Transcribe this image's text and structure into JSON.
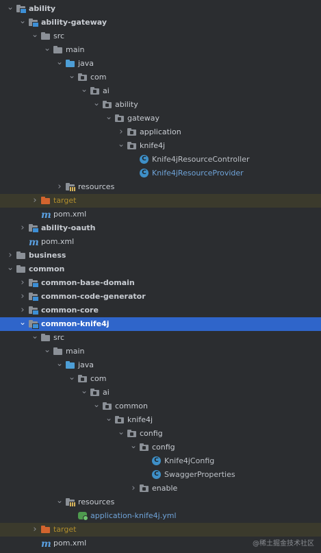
{
  "project_tree": {
    "rows": [
      {
        "label": "ability",
        "level": 0,
        "expanded": true,
        "icon": "module-folder-icon",
        "bold": true
      },
      {
        "label": "ability-gateway",
        "level": 1,
        "expanded": true,
        "icon": "module-folder-icon",
        "bold": true
      },
      {
        "label": "src",
        "level": 2,
        "expanded": true,
        "icon": "folder-icon"
      },
      {
        "label": "main",
        "level": 3,
        "expanded": true,
        "icon": "folder-icon"
      },
      {
        "label": "java",
        "level": 4,
        "expanded": true,
        "icon": "source-folder-icon"
      },
      {
        "label": "com",
        "level": 5,
        "expanded": true,
        "icon": "package-icon"
      },
      {
        "label": "ai",
        "level": 6,
        "expanded": true,
        "icon": "package-icon"
      },
      {
        "label": "ability",
        "level": 7,
        "expanded": true,
        "icon": "package-icon"
      },
      {
        "label": "gateway",
        "level": 8,
        "expanded": true,
        "icon": "package-icon"
      },
      {
        "label": "application",
        "level": 9,
        "expanded": false,
        "icon": "package-icon"
      },
      {
        "label": "knife4j",
        "level": 9,
        "expanded": true,
        "icon": "package-icon"
      },
      {
        "label": "Knife4jResourceController",
        "level": 10,
        "icon": "class-icon",
        "style": "class"
      },
      {
        "label": "Knife4jResourceProvider",
        "level": 10,
        "icon": "class-icon",
        "style": "link"
      },
      {
        "label": "resources",
        "level": 4,
        "expanded": false,
        "icon": "resources-folder-icon"
      },
      {
        "label": "target",
        "level": 2,
        "expanded": false,
        "icon": "excluded-folder-icon",
        "style": "excluded"
      },
      {
        "label": "pom.xml",
        "level": 2,
        "icon": "maven-icon"
      },
      {
        "label": "ability-oauth",
        "level": 1,
        "expanded": false,
        "icon": "module-folder-icon",
        "bold": true
      },
      {
        "label": "pom.xml",
        "level": 1,
        "icon": "maven-icon"
      },
      {
        "label": "business",
        "level": 0,
        "expanded": false,
        "icon": "folder-icon",
        "bold": true
      },
      {
        "label": "common",
        "level": 0,
        "expanded": true,
        "icon": "folder-icon",
        "bold": true
      },
      {
        "label": "common-base-domain",
        "level": 1,
        "expanded": false,
        "icon": "module-folder-icon",
        "bold": true
      },
      {
        "label": "common-code-generator",
        "level": 1,
        "expanded": false,
        "icon": "module-folder-icon",
        "bold": true
      },
      {
        "label": "common-core",
        "level": 1,
        "expanded": false,
        "icon": "module-folder-icon",
        "bold": true
      },
      {
        "label": "common-knife4j",
        "level": 1,
        "expanded": true,
        "icon": "module-folder-icon",
        "bold": true,
        "selected": true
      },
      {
        "label": "src",
        "level": 2,
        "expanded": true,
        "icon": "folder-icon"
      },
      {
        "label": "main",
        "level": 3,
        "expanded": true,
        "icon": "folder-icon"
      },
      {
        "label": "java",
        "level": 4,
        "expanded": true,
        "icon": "source-folder-icon"
      },
      {
        "label": "com",
        "level": 5,
        "expanded": true,
        "icon": "package-icon"
      },
      {
        "label": "ai",
        "level": 6,
        "expanded": true,
        "icon": "package-icon"
      },
      {
        "label": "common",
        "level": 7,
        "expanded": true,
        "icon": "package-icon"
      },
      {
        "label": "knife4j",
        "level": 8,
        "expanded": true,
        "icon": "package-icon"
      },
      {
        "label": "config",
        "level": 9,
        "expanded": true,
        "icon": "package-icon"
      },
      {
        "label": "config",
        "level": 10,
        "expanded": true,
        "icon": "package-icon"
      },
      {
        "label": "Knife4jConfig",
        "level": 11,
        "icon": "class-icon",
        "style": "class"
      },
      {
        "label": "SwaggerProperties",
        "level": 11,
        "icon": "class-icon",
        "style": "class"
      },
      {
        "label": "enable",
        "level": 10,
        "expanded": false,
        "icon": "package-icon"
      },
      {
        "label": "resources",
        "level": 4,
        "expanded": true,
        "icon": "resources-folder-icon"
      },
      {
        "label": "application-knife4j.yml",
        "level": 5,
        "icon": "yml-spring-icon",
        "style": "yml"
      },
      {
        "label": "target",
        "level": 2,
        "expanded": false,
        "icon": "excluded-folder-icon",
        "style": "excluded"
      },
      {
        "label": "pom.xml",
        "level": 2,
        "icon": "maven-icon"
      }
    ]
  },
  "watermark": "@稀土掘金技术社区",
  "colors": {
    "background": "#2b2d30",
    "selection": "#2f65ca",
    "excluded_row": "#3b3a2c",
    "excluded_text": "#b08d2d",
    "link_text": "#6fa3d8"
  }
}
